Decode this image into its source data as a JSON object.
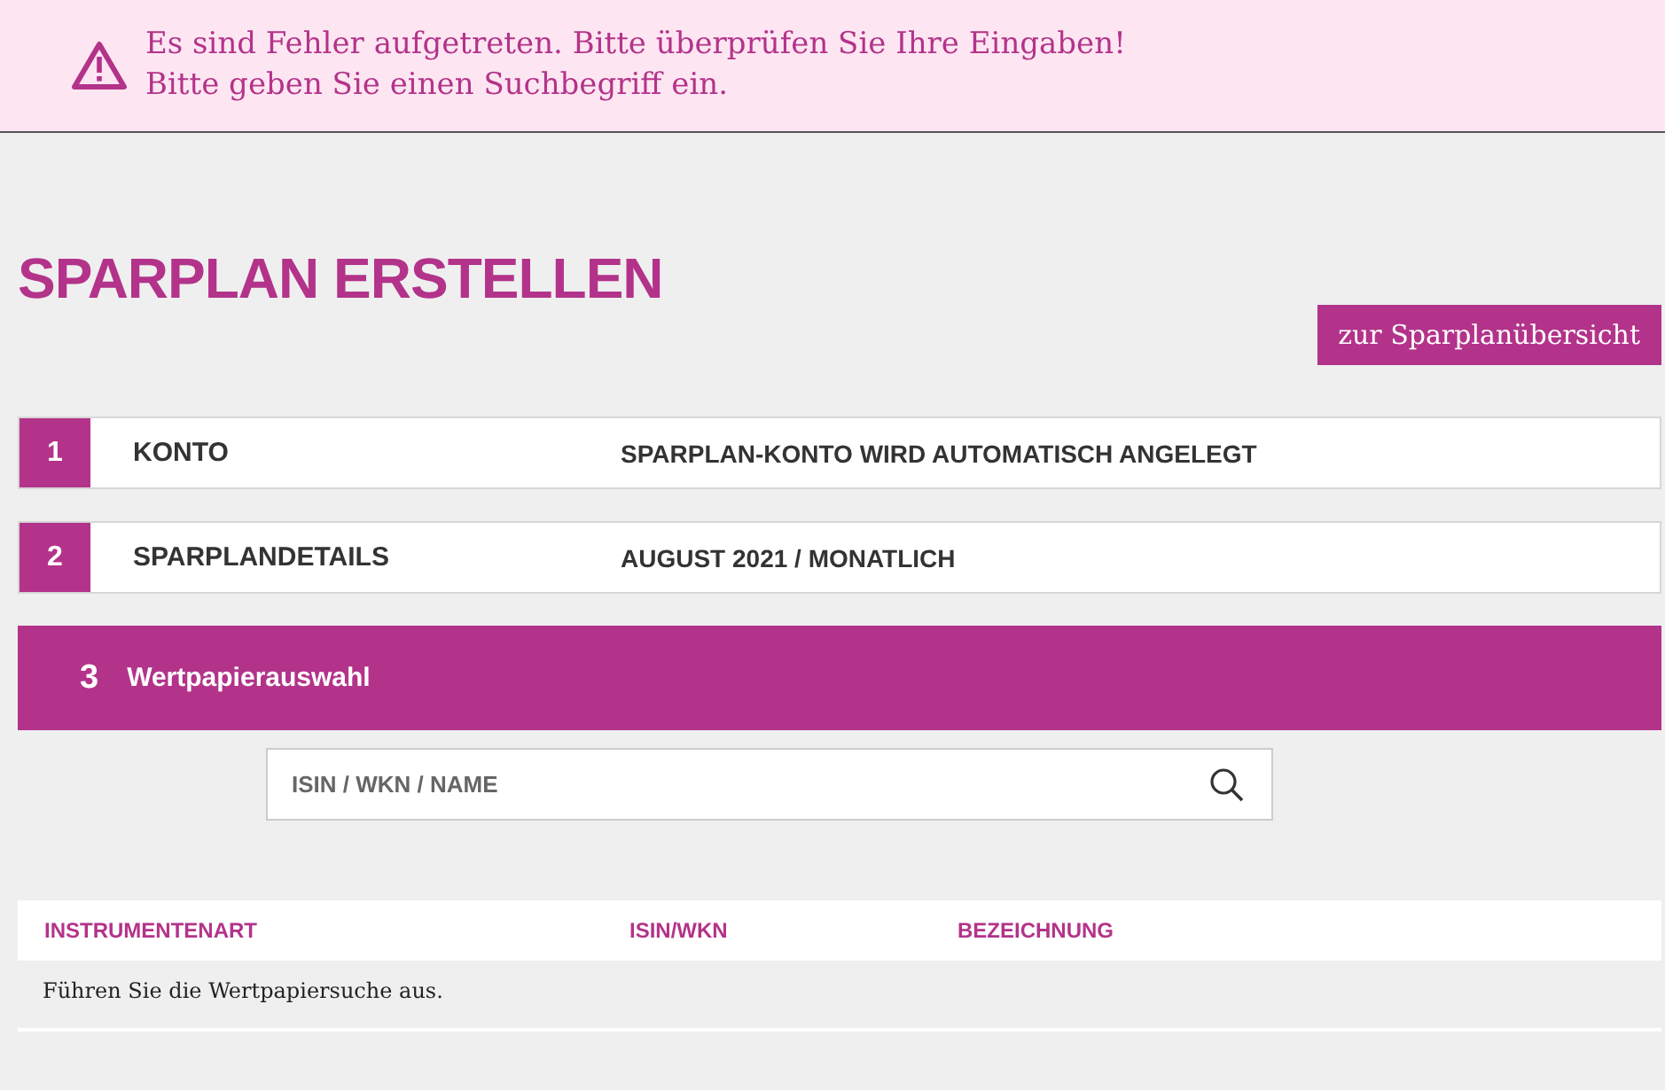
{
  "alert": {
    "messages": [
      "Es sind Fehler aufgetreten. Bitte überprüfen Sie Ihre Eingaben!",
      "Bitte geben Sie einen Suchbegriff ein."
    ]
  },
  "page_title": "SPARPLAN ERSTELLEN",
  "overview_button": "zur Sparplanübersicht",
  "steps": [
    {
      "number": "1",
      "label": "KONTO",
      "summary": "SPARPLAN-KONTO WIRD AUTOMATISCH ANGELEGT",
      "active": false
    },
    {
      "number": "2",
      "label": "SPARPLANDETAILS",
      "summary": "AUGUST 2021 / MONATLICH",
      "active": false
    },
    {
      "number": "3",
      "label": "Wertpapierauswahl",
      "active": true
    }
  ],
  "search": {
    "placeholder": "ISIN / WKN / NAME"
  },
  "table": {
    "columns": [
      "INSTRUMENTENART",
      "ISIN/WKN",
      "BEZEICHNUNG"
    ],
    "empty_message": "Führen Sie die Wertpapiersuche aus."
  }
}
